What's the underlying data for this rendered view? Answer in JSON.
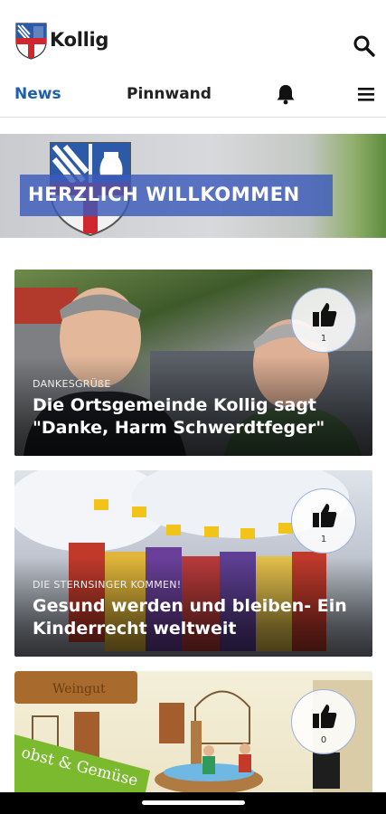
{
  "app": {
    "title": "Kollig",
    "logo_icon": "coat-of-arms-icon"
  },
  "header": {
    "search_icon": "search-icon"
  },
  "tabs": {
    "news": "News",
    "pinnwand": "Pinnwand",
    "bell_icon": "bell-icon",
    "menu_icon": "hamburger-menu-icon",
    "active_color": "#1f5fad"
  },
  "hero": {
    "title": "HERZLICH WILLKOMMEN",
    "banner_color": "#3c5ab9"
  },
  "cards": [
    {
      "category": "DANKESGRÜßE",
      "title": "Die Ortsgemeinde Kollig sagt \"Danke, Harm Schwerdtfeger\"",
      "likes": "1",
      "like_icon": "thumbs-up-icon"
    },
    {
      "category": "DIE STERNSINGER KOMMEN!",
      "title": "Gesund werden und bleiben- Ein Kinderrecht weltweit",
      "likes": "1",
      "like_icon": "thumbs-up-icon"
    },
    {
      "category": "",
      "title": "",
      "likes": "0",
      "like_icon": "thumbs-up-icon",
      "image_text": [
        "Weingut",
        "obst & Gemüse"
      ]
    }
  ],
  "system": {
    "home_indicator": "home-indicator"
  }
}
